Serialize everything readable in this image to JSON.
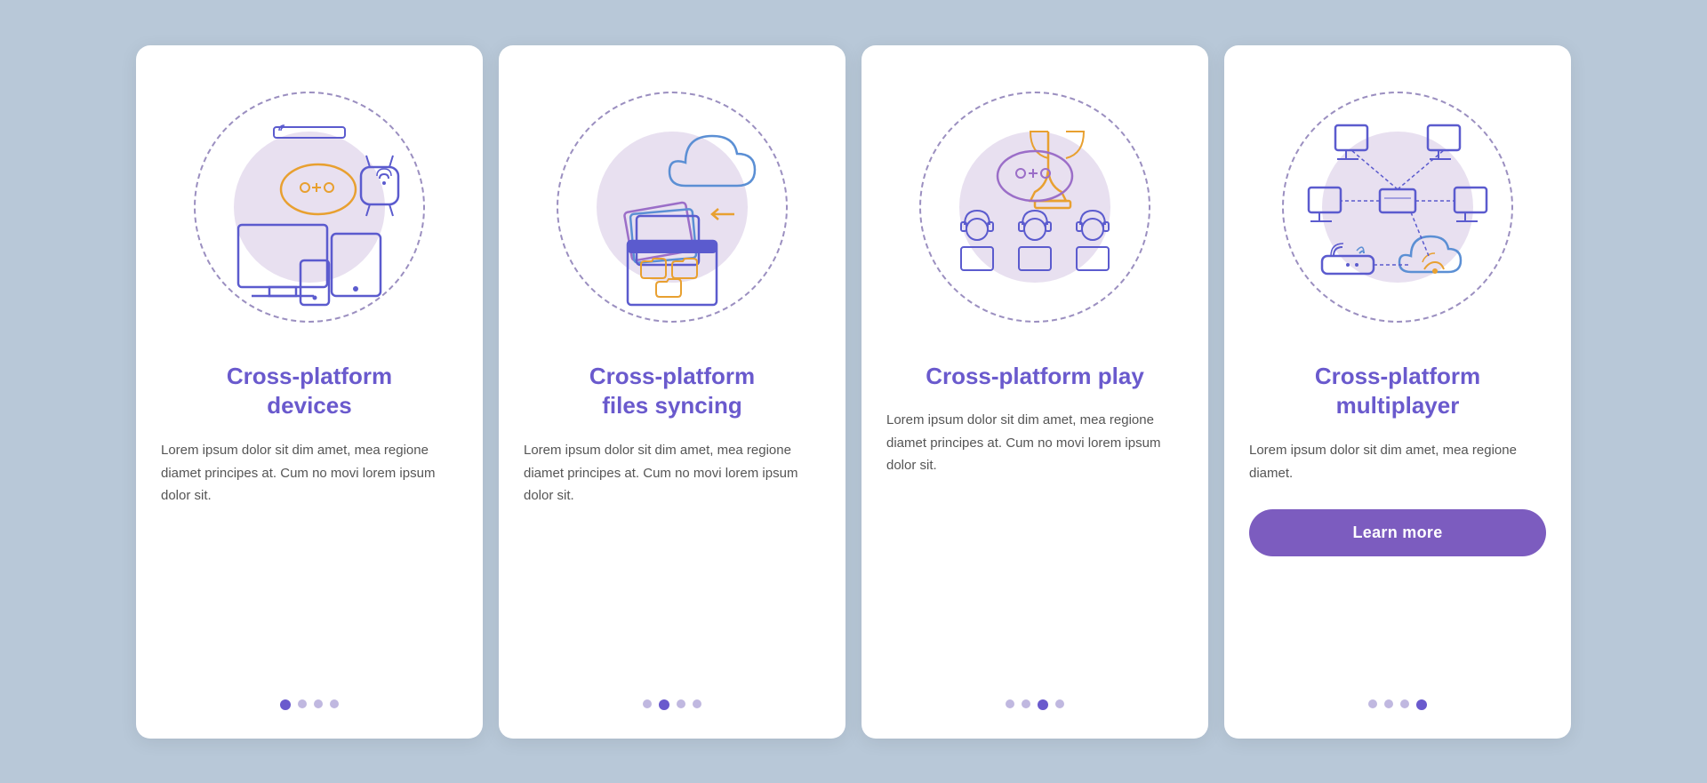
{
  "background_color": "#b8c8d8",
  "cards": [
    {
      "id": "card-1",
      "title": "Cross-platform\ndevices",
      "body": "Lorem ipsum dolor sit dim amet, mea regione diamet principes at. Cum no movi lorem ipsum dolor sit.",
      "dots": [
        true,
        false,
        false,
        false
      ],
      "has_button": false,
      "button_label": ""
    },
    {
      "id": "card-2",
      "title": "Cross-platform\nfiles syncing",
      "body": "Lorem ipsum dolor sit dim amet, mea regione diamet principes at. Cum no movi lorem ipsum dolor sit.",
      "dots": [
        false,
        true,
        false,
        false
      ],
      "has_button": false,
      "button_label": ""
    },
    {
      "id": "card-3",
      "title": "Cross-platform play",
      "body": "Lorem ipsum dolor sit dim amet, mea regione diamet principes at. Cum no movi lorem ipsum dolor sit.",
      "dots": [
        false,
        false,
        true,
        false
      ],
      "has_button": false,
      "button_label": ""
    },
    {
      "id": "card-4",
      "title": "Cross-platform\nmultiplayer",
      "body": "Lorem ipsum dolor sit dim amet, mea regione diamet.",
      "dots": [
        false,
        false,
        false,
        true
      ],
      "has_button": true,
      "button_label": "Learn more"
    }
  ],
  "accent_color": "#6a5acd",
  "button_color": "#7c5cbf",
  "dot_active_color": "#6a5acd",
  "dot_inactive_color": "#c0b8e0"
}
